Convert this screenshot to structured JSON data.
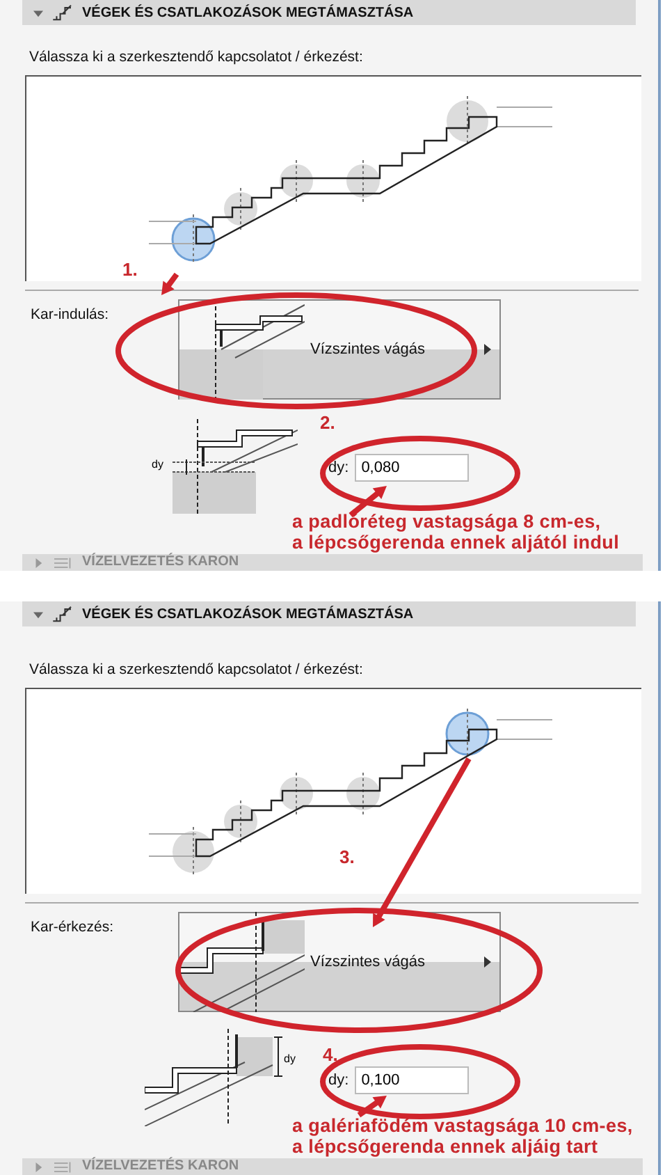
{
  "panels": [
    {
      "section": {
        "title": "VÉGEK ÉS CSATLAKOZÁSOK MEGTÁMASZTÁSA",
        "expanded": true
      },
      "prompt": "Válassza ki a szerkesztendő kapcsolatot / érkezést:",
      "joints": [
        {
          "selected": true
        },
        {
          "selected": false
        },
        {
          "selected": false
        },
        {
          "selected": false
        },
        {
          "selected": false
        }
      ],
      "connection": {
        "kind": "start",
        "label": "Kar-indulás:",
        "value": "Vízszintes vágás"
      },
      "detail": {
        "dimension_label": "dy",
        "field_label": "dy:",
        "value": "0,080"
      },
      "markers": [
        "1.",
        "2."
      ],
      "note": [
        "a padlóréteg vastagsága 8 cm-es,",
        "a lépcsőgerenda ennek aljától indul"
      ],
      "next_section": {
        "title": "VÍZELVEZETÉS KARON",
        "expanded": false
      }
    },
    {
      "section": {
        "title": "VÉGEK ÉS CSATLAKOZÁSOK MEGTÁMASZTÁSA",
        "expanded": true
      },
      "prompt": "Válassza ki a szerkesztendő kapcsolatot / érkezést:",
      "joints": [
        {
          "selected": false
        },
        {
          "selected": false
        },
        {
          "selected": false
        },
        {
          "selected": false
        },
        {
          "selected": true
        }
      ],
      "connection": {
        "kind": "end",
        "label": "Kar-érkezés:",
        "value": "Vízszintes vágás"
      },
      "detail": {
        "dimension_label": "dy",
        "field_label": "dy:",
        "value": "0,100"
      },
      "markers": [
        "3.",
        "4."
      ],
      "note": [
        "a galériafödém vastagsága 10 cm-es,",
        "a lépcsőgerenda ennek aljáig tart"
      ],
      "next_section": {
        "title": "VÍZELVEZETÉS KARON",
        "expanded": false
      }
    }
  ]
}
